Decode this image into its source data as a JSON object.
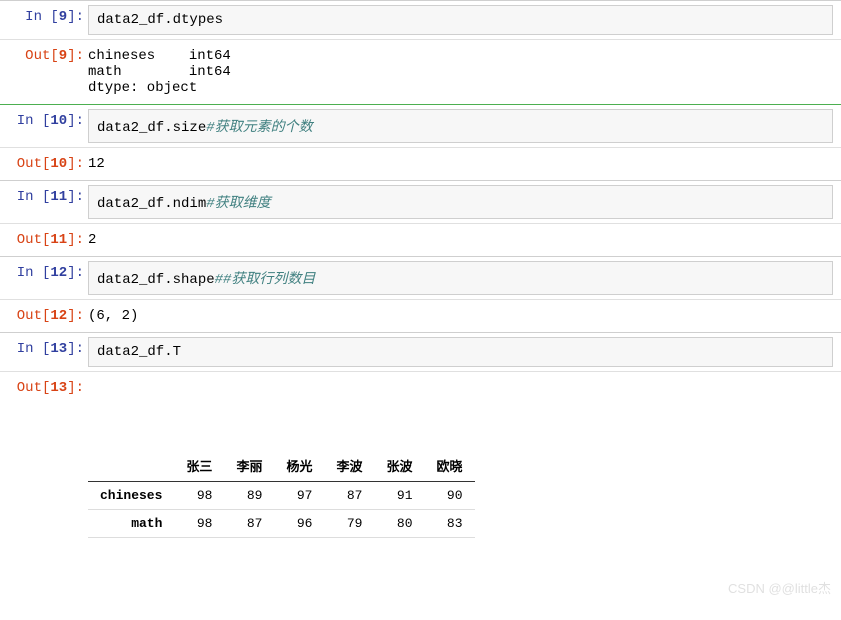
{
  "cells": [
    {
      "in_num": "9",
      "code_plain": "data2_df.dtypes",
      "out_num": "9",
      "output_text": "chineses    int64\nmath        int64\ndtype: object",
      "sep_class": "sep"
    },
    {
      "in_num": "10",
      "code_plain": "data2_df.size",
      "code_comment": "#获取元素的个数",
      "out_num": "10",
      "output_text": "12",
      "sep_class": "sep-green"
    },
    {
      "in_num": "11",
      "code_plain": "data2_df.ndim",
      "code_comment": "#获取维度",
      "out_num": "11",
      "output_text": "2",
      "sep_class": "sep"
    },
    {
      "in_num": "12",
      "code_plain": "data2_df.shape",
      "code_comment": "##获取行列数目",
      "out_num": "12",
      "output_text": "(6, 2)",
      "sep_class": "sep"
    },
    {
      "in_num": "13",
      "code_plain": "data2_df.T",
      "out_num": "13",
      "output_table": {
        "columns": [
          "张三",
          "李丽",
          "杨光",
          "李波",
          "张波",
          "欧晓"
        ],
        "index": [
          "chineses",
          "math"
        ],
        "rows": [
          [
            98,
            89,
            97,
            87,
            91,
            90
          ],
          [
            98,
            87,
            96,
            79,
            80,
            83
          ]
        ]
      },
      "sep_class": "sep"
    }
  ],
  "prompt_labels": {
    "in_prefix": "In  [",
    "in_suffix": "]:",
    "out_prefix": "Out[",
    "out_suffix": "]:"
  },
  "watermark": "CSDN @@little杰"
}
